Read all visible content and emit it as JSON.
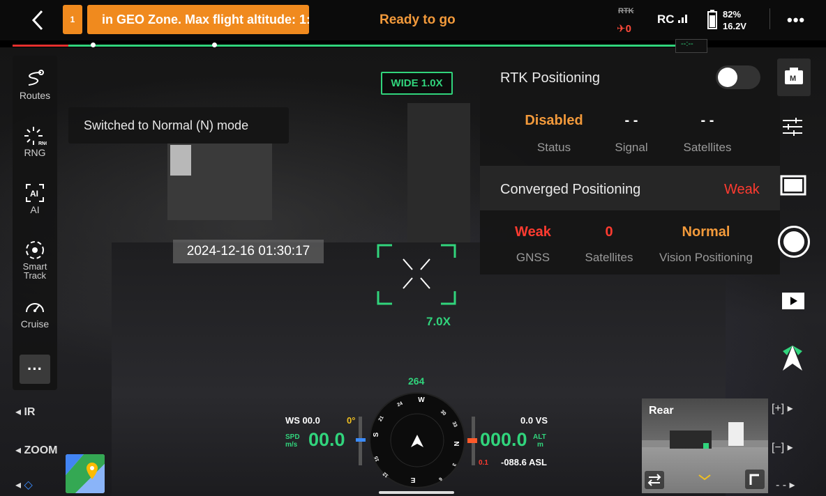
{
  "topbar": {
    "geo_count": "1",
    "geo_banner": "in GEO Zone. Max flight altitude: 1:",
    "status": "Ready to go",
    "rtk_label": "RTK",
    "rtk_satellites": "0",
    "rc_label": "RC",
    "battery_percent": "82%",
    "battery_voltage": "16.2V"
  },
  "progress": {
    "marker_text": "--:--"
  },
  "sidebar": {
    "items": [
      {
        "label": "Routes",
        "icon": "routes-icon"
      },
      {
        "label": "RNG",
        "icon": "rng-icon"
      },
      {
        "label": "AI",
        "icon": "ai-icon"
      },
      {
        "label": "Smart Track",
        "icon": "smart-track-icon"
      },
      {
        "label": "Cruise",
        "icon": "cruise-icon"
      }
    ],
    "more_label": "···"
  },
  "toast": "Switched to Normal (N) mode",
  "timestamp": "2024-12-16 01:30:17",
  "left_controls": {
    "ir": "◂ IR",
    "zoom": "◂ ZOOM",
    "lock": "◂"
  },
  "camera": {
    "mode_badge": "WIDE  1.0X",
    "zoom": "7.0X"
  },
  "rtk_panel": {
    "title": "RTK Positioning",
    "toggle_on": false,
    "status_value": "Disabled",
    "status_label": "Status",
    "signal_value": "- -",
    "signal_label": "Signal",
    "satellites_value": "- -",
    "satellites_label": "Satellites",
    "converged_title": "Converged Positioning",
    "converged_status": "Weak",
    "gnss_value": "Weak",
    "gnss_label": "GNSS",
    "conv_sat_value": "0",
    "conv_sat_label": "Satellites",
    "vision_value": "Normal",
    "vision_label": "Vision Positioning"
  },
  "flight": {
    "ws": "WS 00.0",
    "gimbal_angle": "0°",
    "spd_label": "SPD",
    "spd_unit": "m/s",
    "speed": "00.0",
    "heading": "264",
    "vs": "0.0 VS",
    "alt": "000.0",
    "alt_label": "ALT",
    "alt_unit": "m",
    "small_val": "0.1",
    "asl": "-088.6 ASL",
    "compass_n": "N",
    "compass_s": "S",
    "compass_e": "E",
    "compass_w": "W",
    "compass_24": "24",
    "compass_30": "30",
    "compass_33": "33",
    "compass_3": "3",
    "compass_6": "6",
    "compass_12": "12",
    "compass_15": "15",
    "compass_21": "21"
  },
  "rear_cam": {
    "label": "Rear"
  },
  "right_controls": {
    "plus": "[+]",
    "minus": "[−]",
    "dash": "- -"
  },
  "colors": {
    "accent_green": "#31d47c",
    "warning_orange": "#f08a1e",
    "alert_red": "#ff3b30"
  }
}
